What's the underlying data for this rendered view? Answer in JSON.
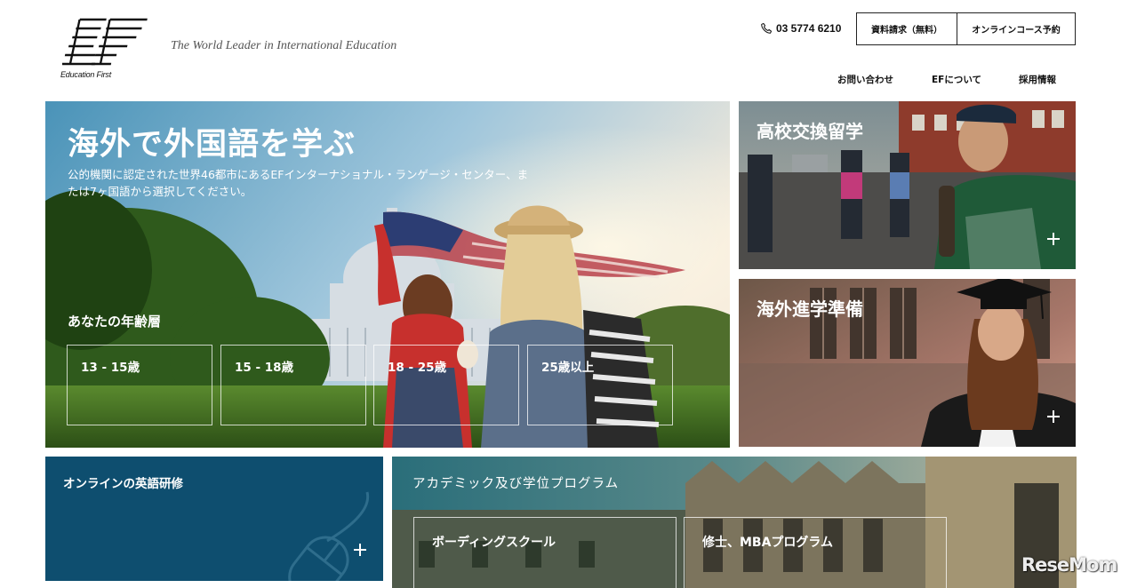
{
  "header": {
    "logo_text": "EF",
    "logo_subtext": "Education First",
    "tagline": "The World Leader in International Education",
    "phone": "03 5774 6210",
    "request_button": "資料請求（無料）",
    "online_course_button": "オンラインコース予約",
    "nav": [
      "お問い合わせ",
      "EFについて",
      "採用情報"
    ]
  },
  "hero": {
    "title": "海外で外国語を学ぶ",
    "description": "公的機関に認定された世界46都市にあるEFインターナショナル・ランゲージ・センター、または7ヶ国語から選択してください。",
    "age_heading": "あなたの年齢層",
    "age_options": [
      "13 - 15歳",
      "15 - 18歳",
      "18 - 25歳",
      "25歳以上"
    ]
  },
  "tiles": {
    "high_school_exchange": "高校交換留学",
    "study_abroad_prep": "海外進学準備",
    "online_english": "オンラインの英語研修",
    "academic_programs": {
      "title": "アカデミック及び学位プログラム",
      "options": [
        "ボーディングスクール",
        "修士、MBAプログラム"
      ]
    }
  },
  "watermark": "ReseMom",
  "colors": {
    "online_tile": "#0e4e6f",
    "text_on_image": "#ffffff",
    "header_text": "#111111"
  },
  "icons": [
    "phone-icon",
    "plus-icon",
    "computer-mouse-icon"
  ]
}
